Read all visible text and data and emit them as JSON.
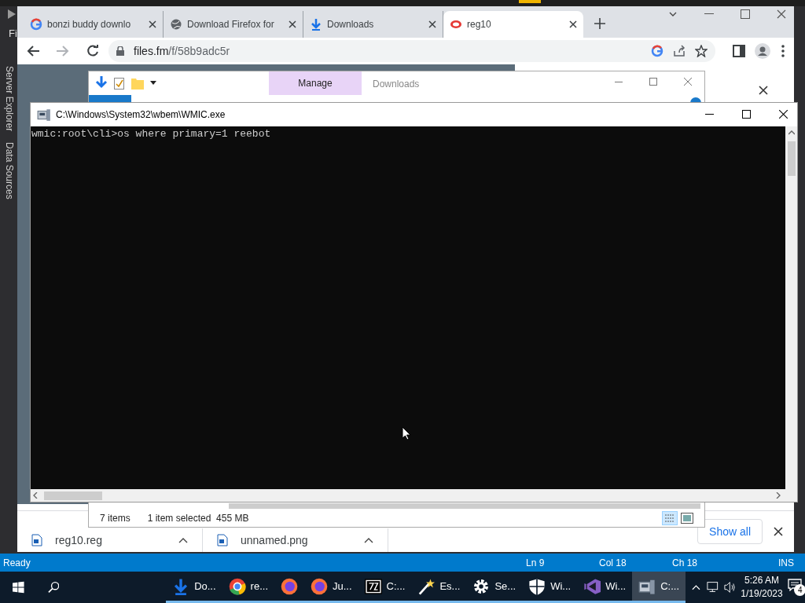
{
  "ide": {
    "menu_fragment": "Fi",
    "side_tabs": [
      "Server Explorer",
      "Data Sources"
    ],
    "status_bar": {
      "state": "Ready",
      "line": "Ln 9",
      "column": "Col 18",
      "char": "Ch 18",
      "mode": "INS"
    }
  },
  "browser": {
    "tabs": [
      {
        "title": "bonzi buddy downlo",
        "kind": "google",
        "selected": false
      },
      {
        "title": "Download Firefox for",
        "kind": "globe",
        "selected": false
      },
      {
        "title": "Downloads",
        "kind": "download",
        "selected": false
      },
      {
        "title": "reg10",
        "kind": "files",
        "selected": true
      }
    ],
    "url_host": "files.fm",
    "url_path": "/f/58b9adc5r",
    "downloads": [
      {
        "name": "reg10.reg"
      },
      {
        "name": "unnamed.png"
      }
    ],
    "show_all": "Show all"
  },
  "explorer": {
    "ribbon_tab": "Manage",
    "title": "Downloads",
    "item_count": "7 items",
    "selection": "1 item selected  455 MB"
  },
  "console": {
    "title": "C:\\Windows\\System32\\wbem\\WMIC.exe",
    "lines": [
      "wmic:root\\cli>os where primary=1 reebot"
    ]
  },
  "taskbar": {
    "items": [
      {
        "label": "Do...",
        "kind": "download",
        "active": false
      },
      {
        "label": "re...",
        "kind": "chrome",
        "active": false
      },
      {
        "kind": "firefox",
        "active": false
      },
      {
        "label": "Ju...",
        "kind": "firefox",
        "active": false
      },
      {
        "label": "C:...",
        "kind": "archive",
        "active": false
      },
      {
        "label": "Es...",
        "kind": "wand",
        "active": false
      },
      {
        "label": "Se...",
        "kind": "gear",
        "active": false
      },
      {
        "label": "Wi...",
        "kind": "shield",
        "active": false
      },
      {
        "label": "Wi...",
        "kind": "vs",
        "active": false
      },
      {
        "label": "C:...",
        "kind": "console",
        "active": true
      }
    ],
    "time": "5:26 AM",
    "date": "1/19/2023",
    "notifications": "4"
  }
}
